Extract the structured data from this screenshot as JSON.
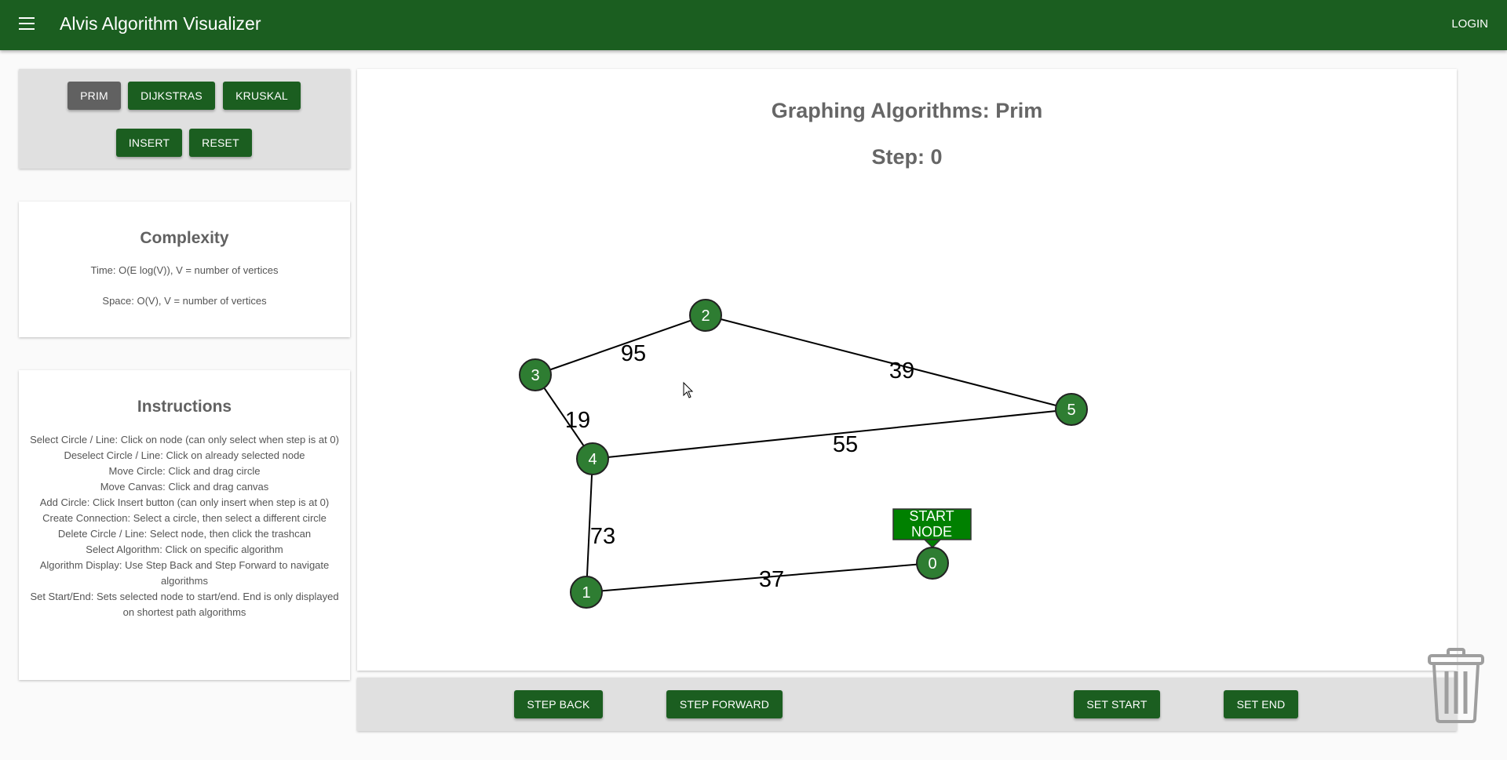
{
  "app": {
    "title": "Alvis Algorithm Visualizer",
    "login": "LOGIN"
  },
  "algorithm_panel": {
    "buttons": [
      "PRIM",
      "DIJKSTRAS",
      "KRUSKAL"
    ],
    "selected": "PRIM",
    "insert": "INSERT",
    "reset": "RESET"
  },
  "complexity": {
    "title": "Complexity",
    "time": "Time: O(E log(V)), V = number of vertices",
    "space": "Space: O(V), V = number of vertices"
  },
  "instructions": {
    "title": "Instructions",
    "lines": [
      "Select Circle / Line: Click on node (can only select when step is at 0)",
      "Deselect Circle / Line: Click on already selected node",
      "Move Circle: Click and drag circle",
      "Move Canvas: Click and drag canvas",
      "Add Circle: Click Insert button (can only insert when step is at 0)",
      "Create Connection: Select a circle, then select a different circle",
      "Delete Circle / Line: Select node, then click the trashcan",
      "Select Algorithm: Click on specific algorithm",
      "Algorithm Display: Use Step Back and Step Forward to navigate algorithms",
      "Set Start/End: Sets selected node to start/end. End is only displayed on shortest path algorithms"
    ]
  },
  "canvas": {
    "title": "Graphing Algorithms: Prim",
    "step": "Step: 0",
    "start_label_line1": "START",
    "start_label_line2": "NODE"
  },
  "graph": {
    "nodes": [
      "0",
      "1",
      "2",
      "3",
      "4",
      "5"
    ],
    "edges": [
      {
        "from": "2",
        "to": "3",
        "weight": "95"
      },
      {
        "from": "2",
        "to": "5",
        "weight": "39"
      },
      {
        "from": "3",
        "to": "4",
        "weight": "19"
      },
      {
        "from": "4",
        "to": "5",
        "weight": "55"
      },
      {
        "from": "4",
        "to": "1",
        "weight": "73"
      },
      {
        "from": "1",
        "to": "0",
        "weight": "37"
      }
    ],
    "start_node": "0"
  },
  "controls": {
    "step_back": "STEP BACK",
    "step_forward": "STEP FORWARD",
    "set_start": "SET START",
    "set_end": "SET END"
  },
  "icons": {
    "menu": "menu-icon",
    "trash": "trash-icon"
  },
  "colors": {
    "primary": "#1b5e20",
    "node": "#2e7d32",
    "selected_button": "#616161"
  }
}
